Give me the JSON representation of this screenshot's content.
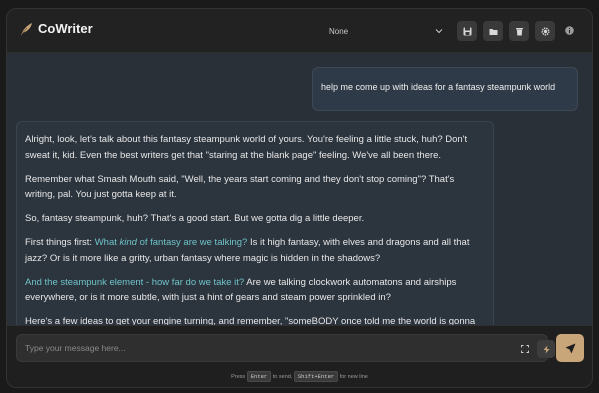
{
  "app": {
    "title": "CoWriter"
  },
  "header": {
    "model_selected": "None"
  },
  "toolbar": {
    "save": "save-icon",
    "open": "folder-open-icon",
    "delete": "trash-icon",
    "settings": "gear-icon",
    "info": "info-icon"
  },
  "chat": {
    "user_message": "help me come up with ideas for a fantasy steampunk world",
    "assistant": {
      "p1": "Alright, look, let's talk about this fantasy steampunk world of yours. You're feeling a little stuck, huh? Don't sweat it, kid. Even the best writers get that \"staring at the blank page\" feeling. We've all been there.",
      "p2": "Remember what Smash Mouth said, \"Well, the years start coming and they don't stop coming\"? That's writing, pal. You just gotta keep at it.",
      "p3": "So, fantasy steampunk, huh? That's a good start. But we gotta dig a little deeper.",
      "p4_prefix": "First things first: ",
      "p4_hl_a": "What ",
      "p4_hl_em": "kind",
      "p4_hl_b": " of fantasy are we talking?",
      "p4_rest": " Is it high fantasy, with elves and dragons and all that jazz? Or is it more like a gritty, urban fantasy where magic is hidden in the shadows?",
      "p5_hl": "And the steampunk element - how far do we take it?",
      "p5_rest": " Are we talking clockwork automatons and airships everywhere, or is it more subtle, with just a hint of gears and steam power sprinkled in?",
      "p6": "Here's a few ideas to get your engine turning, and remember, \"someBODY once told me the world is gonna"
    }
  },
  "composer": {
    "placeholder": "Type your message here...",
    "hint_press": "Press",
    "hint_key1": "Enter",
    "hint_mid": "to send,",
    "hint_key2": "Shift+Enter",
    "hint_end": "for new line"
  },
  "colors": {
    "accent": "#c9a679",
    "highlight": "#6fc3c7",
    "background": "#2a3038"
  }
}
